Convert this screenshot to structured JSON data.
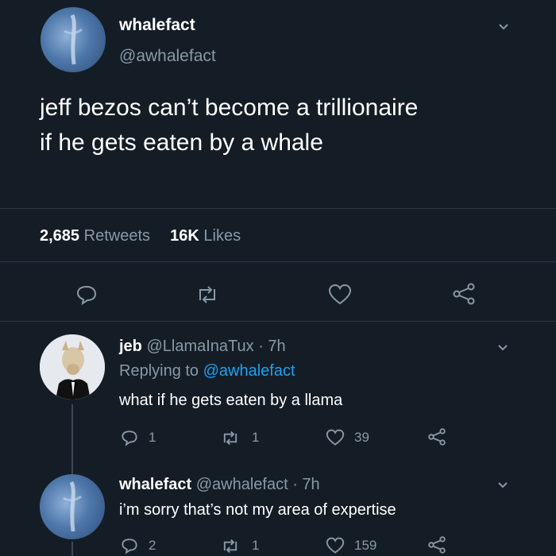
{
  "main_tweet": {
    "display_name": "whalefact",
    "handle": "@awhalefact",
    "text_line1": "jeff bezos can’t become a trillionaire",
    "text_line2": "if he gets eaten by a whale",
    "retweets_count": "2,685",
    "retweets_label": "Retweets",
    "likes_count": "16K",
    "likes_label": "Likes"
  },
  "replies": [
    {
      "display_name": "jeb",
      "handle": "@LlamaInaTux",
      "time": "· 7h",
      "replying_label": "Replying to",
      "replying_handle": "@awhalefact",
      "text": "what if he gets eaten by a llama",
      "reply_count": "1",
      "retweet_count": "1",
      "like_count": "39"
    },
    {
      "display_name": "whalefact",
      "handle": "@awhalefact",
      "time": "· 7h",
      "text": "i’m sorry that’s not my area of expertise",
      "reply_count": "2",
      "retweet_count": "1",
      "like_count": "159"
    }
  ],
  "icons": [
    "chevron-down-icon",
    "reply-icon",
    "retweet-icon",
    "like-icon",
    "share-icon"
  ],
  "colors": {
    "background": "#141d26",
    "muted": "#8899a6",
    "link": "#1da1f2"
  }
}
